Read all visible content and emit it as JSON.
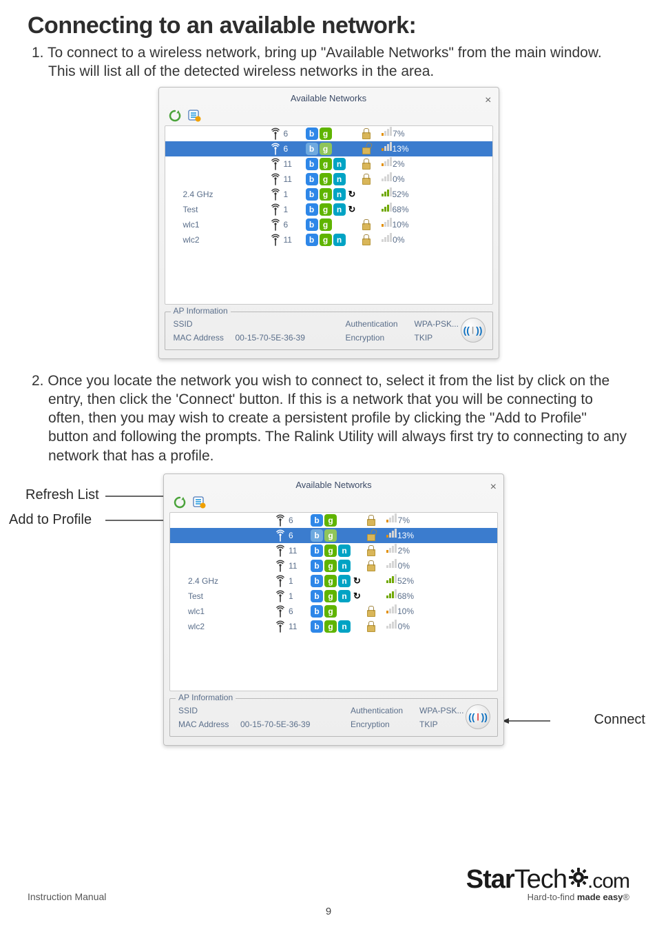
{
  "heading": "Connecting to an available network:",
  "step1": "1.  To connect to a wireless network, bring up \"Available Networks\" from the main window.  This will list all of the detected wireless networks in the area.",
  "step2": "2.  Once you locate the network you wish to connect to, select it from the list by click on the entry, then click the 'Connect' button.  If this is a network that you will be connecting to often, then you may wish to create a persistent profile by clicking the \"Add to Profile\" button and following the prompts.  The Ralink Utility will always first try to connecting to any network that has a profile.",
  "panel_title": "Available Networks",
  "close_glyph": "×",
  "refresh_glyph": "↻",
  "addprofile_glyph": "≡",
  "networks": [
    {
      "name": "",
      "ch": "6",
      "b": true,
      "g": true,
      "n": false,
      "wps": false,
      "lock": "closed",
      "sig": "7%",
      "lvl": 1,
      "sel": false
    },
    {
      "name": "",
      "ch": "6",
      "b": true,
      "g": true,
      "n": false,
      "wps": false,
      "lock": "open",
      "sig": "13%",
      "lvl": 1,
      "sel": true
    },
    {
      "name": "",
      "ch": "11",
      "b": true,
      "g": true,
      "n": true,
      "wps": false,
      "lock": "closed",
      "sig": "2%",
      "lvl": 1,
      "sel": false
    },
    {
      "name": "",
      "ch": "11",
      "b": true,
      "g": true,
      "n": true,
      "wps": false,
      "lock": "closed",
      "sig": "0%",
      "lvl": 0,
      "sel": false
    },
    {
      "name": "2.4 GHz",
      "ch": "1",
      "b": true,
      "g": true,
      "n": true,
      "wps": true,
      "lock": "none",
      "sig": "52%",
      "lvl": 3,
      "sel": false
    },
    {
      "name": "Test",
      "ch": "1",
      "b": true,
      "g": true,
      "n": true,
      "wps": true,
      "lock": "none",
      "sig": "68%",
      "lvl": 3,
      "sel": false
    },
    {
      "name": "wlc1",
      "ch": "6",
      "b": true,
      "g": true,
      "n": false,
      "wps": false,
      "lock": "closed",
      "sig": "10%",
      "lvl": 1,
      "sel": false
    },
    {
      "name": "wlc2",
      "ch": "11",
      "b": true,
      "g": true,
      "n": true,
      "wps": false,
      "lock": "closed",
      "sig": "0%",
      "lvl": 0,
      "sel": false
    }
  ],
  "ap_legend": "AP Information",
  "ap": {
    "ssid_lbl": "SSID",
    "ssid_val": "",
    "auth_lbl": "Authentication",
    "auth_val": "WPA-PSK...",
    "mac_lbl": "MAC Address",
    "mac_val": "00-15-70-5E-36-39",
    "enc_lbl": "Encryption",
    "enc_val": "TKIP"
  },
  "callouts": {
    "refresh": "Refresh List",
    "addprofile": "Add to Profile",
    "connect": "Connect"
  },
  "footer": {
    "instr": "Instruction Manual",
    "page": "9",
    "brand_a": "Star",
    "brand_b": "Tech",
    "brand_c": ".com",
    "tag_a": "Hard-to-find ",
    "tag_b": "made easy",
    "tag_c": "®"
  }
}
